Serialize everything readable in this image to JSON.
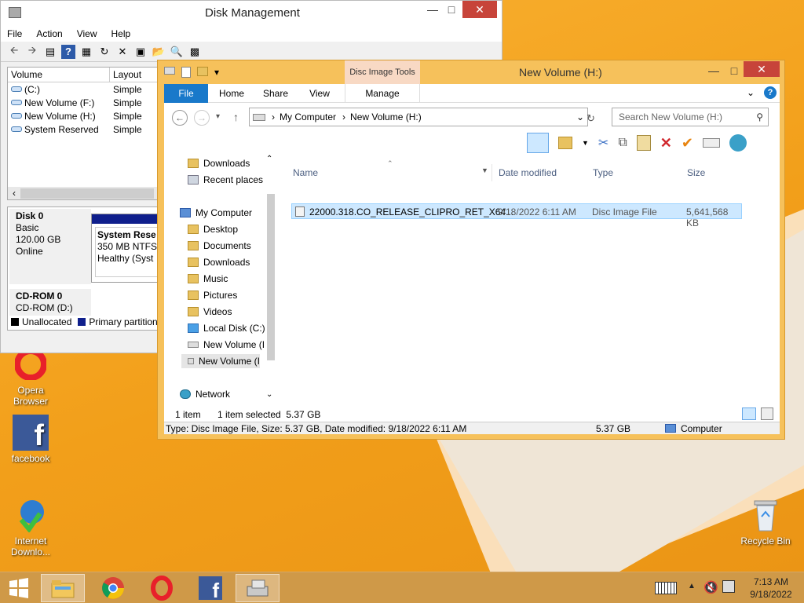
{
  "colors": {
    "accent": "#1979ca",
    "explorer_frame": "#f6c15b",
    "close": "#c7443a",
    "desktop": "#f29f1a"
  },
  "desktop": {
    "icons": [
      {
        "label": "Opera\nBrowser",
        "icon": "opera-icon"
      },
      {
        "label": "facebook",
        "icon": "facebook-icon"
      },
      {
        "label": "Internet\nDownlo...",
        "icon": "idm-icon"
      },
      {
        "label": "Recycle Bin",
        "icon": "recycle-bin-icon"
      }
    ]
  },
  "disk_management": {
    "title": "Disk Management",
    "menu": [
      "File",
      "Action",
      "View",
      "Help"
    ],
    "columns": [
      "Volume",
      "Layout"
    ],
    "volumes": [
      {
        "name": "(C:)",
        "layout": "Simple"
      },
      {
        "name": "New Volume (F:)",
        "layout": "Simple"
      },
      {
        "name": "New Volume (H:)",
        "layout": "Simple"
      },
      {
        "name": "System Reserved",
        "layout": "Simple"
      }
    ],
    "disk0": {
      "name": "Disk 0",
      "type": "Basic",
      "size": "120.00 GB",
      "status": "Online",
      "part_name": "System Rese",
      "part_size": "350 MB NTFS",
      "part_status": "Healthy (Syst"
    },
    "cdrom": {
      "name": "CD-ROM 0",
      "sub": "CD-ROM (D:)"
    },
    "legend": [
      "Unallocated",
      "Primary partition"
    ]
  },
  "explorer": {
    "title": "New Volume (H:)",
    "context_tab": "Disc Image Tools",
    "tabs": [
      "File",
      "Home",
      "Share",
      "View"
    ],
    "manage": "Manage",
    "path": [
      "My Computer",
      "New Volume (H:)"
    ],
    "search_placeholder": "Search New Volume (H:)",
    "nav": [
      "Downloads",
      "Recent places",
      "My Computer",
      "Desktop",
      "Documents",
      "Downloads",
      "Music",
      "Pictures",
      "Videos",
      "Local Disk (C:)",
      "New Volume (I",
      "New Volume (I",
      "Network"
    ],
    "columns": [
      "Name",
      "Date modified",
      "Type",
      "Size"
    ],
    "file": {
      "name": "22000.318.CO_RELEASE_CLIPRO_RET_X64...",
      "date": "9/18/2022 6:11 AM",
      "type": "Disc Image File",
      "size": "5,641,568 KB"
    },
    "status_items": "1 item",
    "status_selected": "1 item selected  5.37 GB",
    "details": "Type: Disc Image File, Size: 5.37 GB, Date modified: 9/18/2022 6:11 AM",
    "details_size": "5.37 GB",
    "details_location": "Computer"
  },
  "taskbar": {
    "time": "7:13 AM",
    "date": "9/18/2022"
  }
}
